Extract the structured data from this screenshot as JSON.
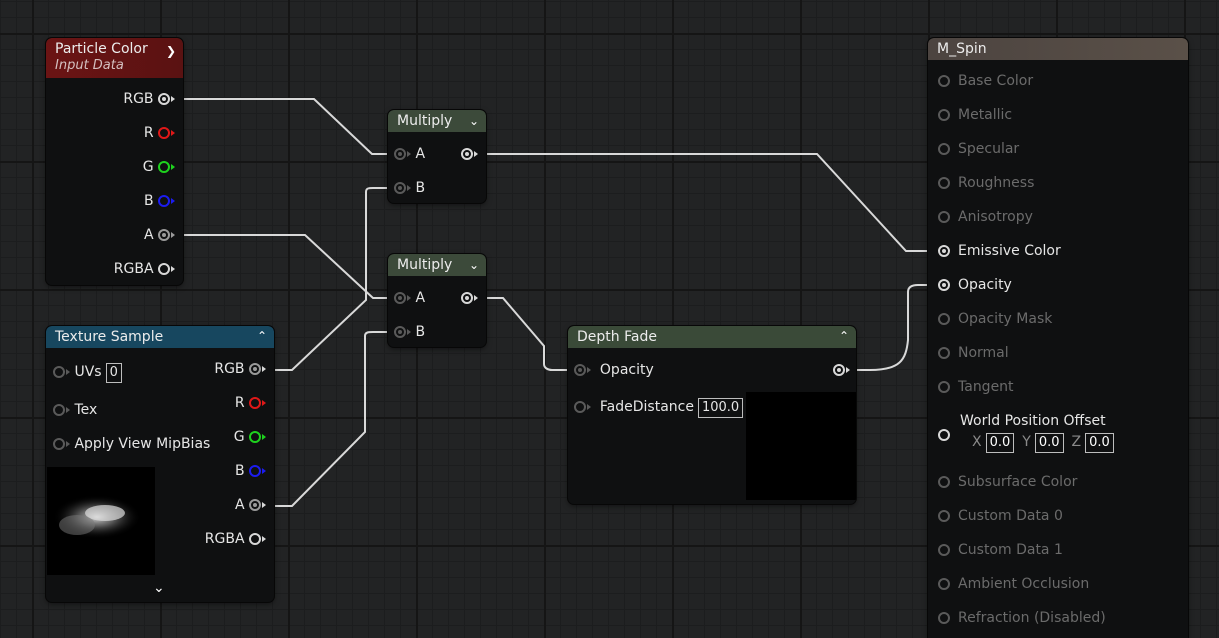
{
  "particle_color": {
    "title": "Particle Color",
    "subtitle": "Input Data",
    "outputs": [
      "RGB",
      "R",
      "G",
      "B",
      "A",
      "RGBA"
    ]
  },
  "texture_sample": {
    "title": "Texture Sample",
    "inputs": [
      {
        "label": "UVs",
        "value": "0"
      },
      {
        "label": "Tex"
      },
      {
        "label": "Apply View MipBias"
      }
    ],
    "outputs": [
      "RGB",
      "R",
      "G",
      "B",
      "A",
      "RGBA"
    ]
  },
  "multiply_1": {
    "title": "Multiply",
    "inputs": [
      "A",
      "B"
    ]
  },
  "multiply_2": {
    "title": "Multiply",
    "inputs": [
      "A",
      "B"
    ]
  },
  "depth_fade": {
    "title": "Depth Fade",
    "inputs": [
      {
        "label": "Opacity"
      },
      {
        "label": "FadeDistance",
        "value": "100.0"
      }
    ]
  },
  "material": {
    "title": "M_Spin",
    "pins": [
      "Base Color",
      "Metallic",
      "Specular",
      "Roughness",
      "Anisotropy",
      "Emissive Color",
      "Opacity",
      "Opacity Mask",
      "Normal",
      "Tangent",
      "World Position Offset",
      "Subsurface Color",
      "Custom Data 0",
      "Custom Data 1",
      "Ambient Occlusion",
      "Refraction (Disabled)"
    ],
    "wpo": {
      "x_label": "X",
      "x": "0.0",
      "y_label": "Y",
      "y": "0.0",
      "z_label": "Z",
      "z": "0.0"
    }
  },
  "colors": {
    "particle_header": "#6b1414",
    "texture_header": "#17475f",
    "multiply_header": "#3c4a3a",
    "depthfade_header": "#3a4a38",
    "material_header": "#4c4440"
  }
}
